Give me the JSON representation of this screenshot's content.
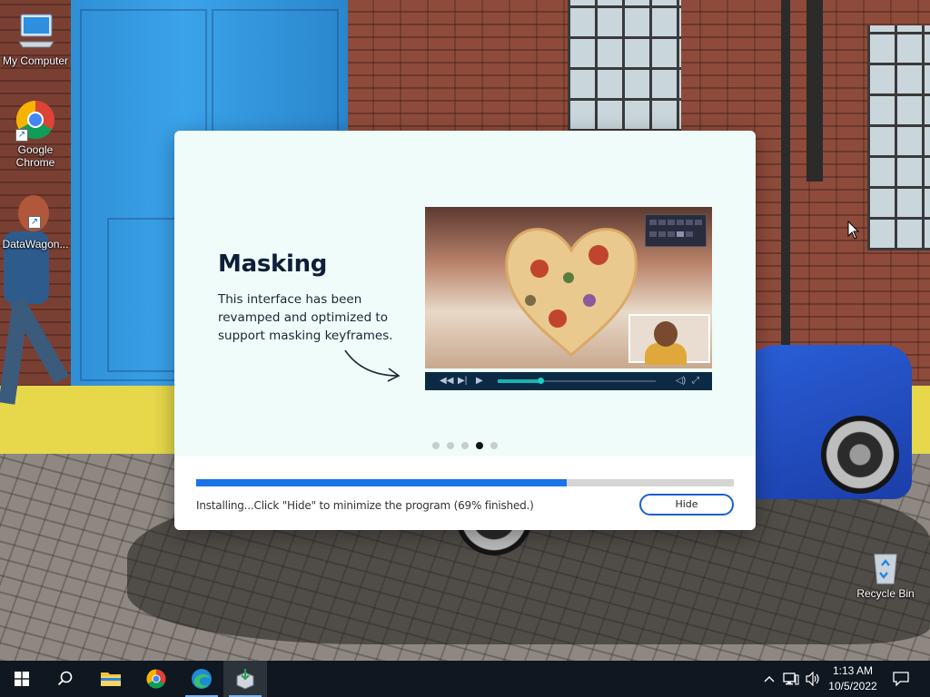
{
  "desktop": {
    "icons": [
      {
        "label": "My Computer",
        "icon": "monitor-icon"
      },
      {
        "label": "Google Chrome",
        "icon": "chrome-icon"
      },
      {
        "label": "DataWagon...",
        "icon": "datawagon-icon"
      },
      {
        "label": "Recycle Bin",
        "icon": "recycle-bin-icon"
      }
    ]
  },
  "installer": {
    "slide_title": "Masking",
    "slide_description": "This interface has been revamped and optimized to support masking keyframes.",
    "carousel": {
      "count": 5,
      "active_index": 3
    },
    "progress_fraction": 0.69,
    "status_text": "Installing...Click \"Hide\" to minimize the program (69% finished.)",
    "hide_label": "Hide",
    "accent_color": "#1a73e8"
  },
  "taskbar": {
    "items": [
      {
        "name": "start-button",
        "icon": "windows-logo-icon"
      },
      {
        "name": "search-button",
        "icon": "search-icon"
      },
      {
        "name": "file-explorer",
        "icon": "folder-icon"
      },
      {
        "name": "google-chrome",
        "icon": "chrome-icon"
      },
      {
        "name": "microsoft-edge",
        "icon": "edge-icon"
      },
      {
        "name": "installer-app",
        "icon": "installer-icon"
      }
    ],
    "clock": {
      "time": "1:13 AM",
      "date": "10/5/2022"
    }
  }
}
